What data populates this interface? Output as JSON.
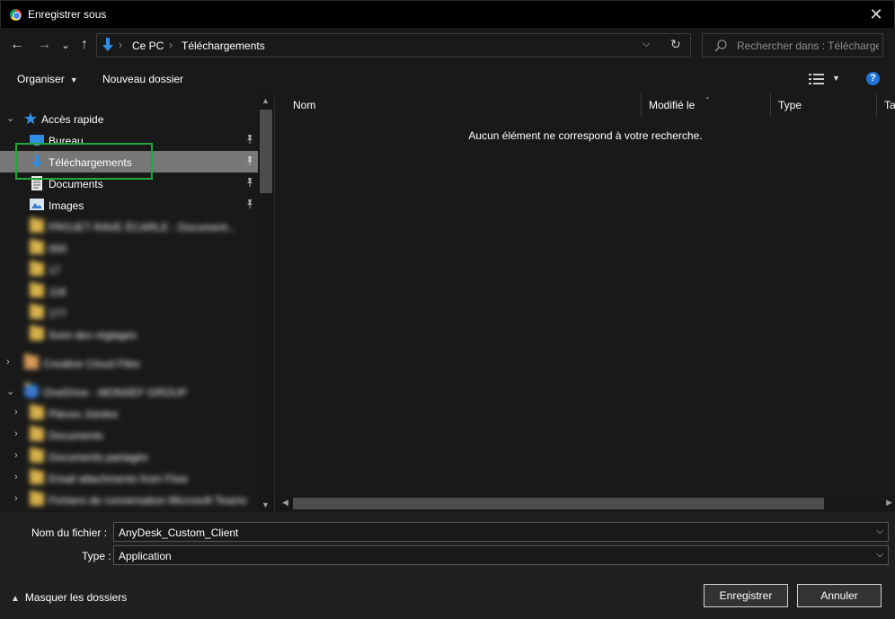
{
  "window": {
    "title": "Enregistrer sous",
    "app_icon": "chrome-icon",
    "close_glyph": "✕"
  },
  "nav": {
    "back_glyph": "←",
    "forward_glyph": "→",
    "recent_glyph": "⌄",
    "up_glyph": "↑",
    "breadcrumb": [
      "Ce PC",
      "Téléchargements"
    ],
    "refresh_glyph": "↻",
    "search_placeholder": "Rechercher dans : Téléchargements"
  },
  "toolbar": {
    "organize_label": "Organiser",
    "new_folder_label": "Nouveau dossier",
    "help_label": "?"
  },
  "sidebar": {
    "quick_access_label": "Accès rapide",
    "pinned": [
      {
        "label": "Bureau",
        "icon": "desktop-icon"
      },
      {
        "label": "Téléchargements",
        "icon": "download-icon"
      },
      {
        "label": "Documents",
        "icon": "document-icon"
      },
      {
        "label": "Images",
        "icon": "picture-icon"
      }
    ],
    "recent_folders": [
      {
        "label": "PROJET RAVE ÉCARLE - Document..."
      },
      {
        "label": "000"
      },
      {
        "label": "17"
      },
      {
        "label": "118"
      },
      {
        "label": "177"
      },
      {
        "label": "Suivi des réglages"
      }
    ],
    "roots": [
      {
        "label": "Creative Cloud Files"
      },
      {
        "label": "OneDrive - MONSEF GROUP"
      }
    ],
    "onedrive_children": [
      {
        "label": "Pièces Jointes"
      },
      {
        "label": "Documents"
      },
      {
        "label": "Documents partagés"
      },
      {
        "label": "Email attachments from Flow"
      },
      {
        "label": "Fichiers de conversation Microsoft Teams"
      }
    ]
  },
  "content": {
    "columns": [
      "Nom",
      "Modifié le",
      "Type",
      "Taille"
    ],
    "empty_message": "Aucun élément ne correspond à votre recherche."
  },
  "form": {
    "filename_label": "Nom du fichier :",
    "filename_value": "AnyDesk_Custom_Client",
    "type_label": "Type :",
    "type_value": "Application",
    "hide_folders_label": "Masquer les dossiers",
    "save_label": "Enregistrer",
    "cancel_label": "Annuler"
  },
  "colors": {
    "background": "#191919",
    "selection": "#777777",
    "highlight_box": "#21a63c",
    "accent": "#1e73d8"
  }
}
